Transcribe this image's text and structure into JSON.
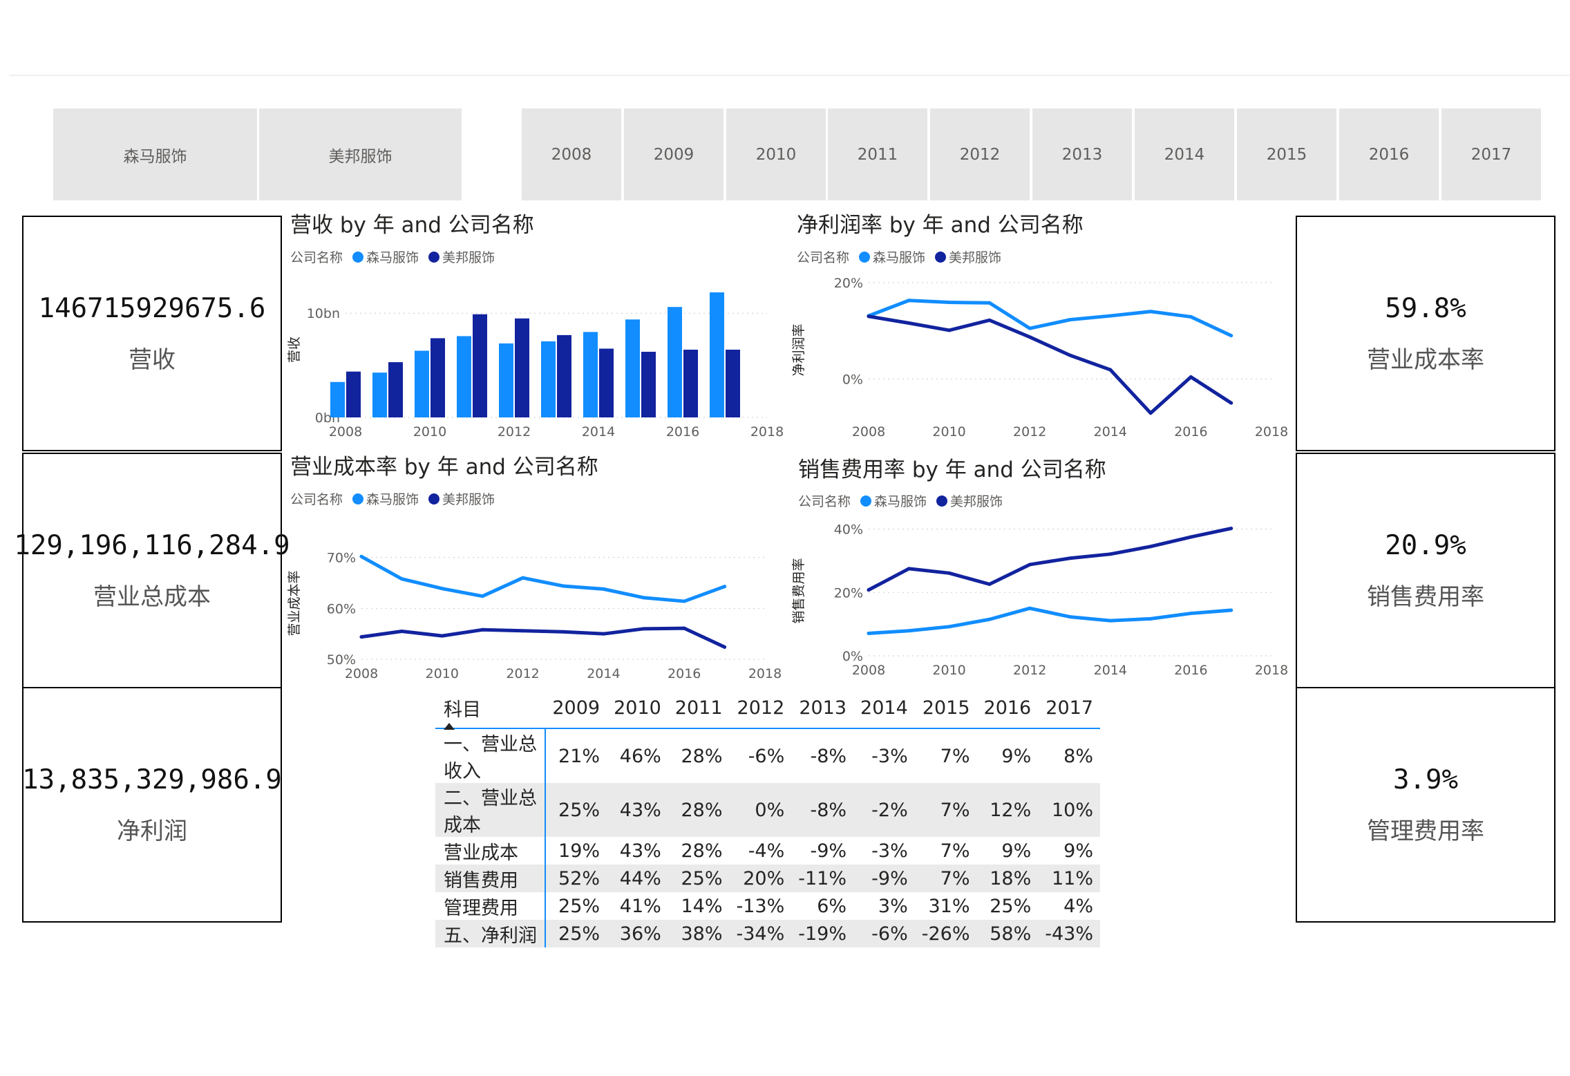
{
  "slicers": {
    "companies": [
      "森马服饰",
      "美邦服饰"
    ],
    "years": [
      "2008",
      "2009",
      "2010",
      "2011",
      "2012",
      "2013",
      "2014",
      "2015",
      "2016",
      "2017"
    ]
  },
  "kpi": {
    "revenue": {
      "value": "146715929675.6",
      "label": "营收"
    },
    "total_cost": {
      "value": "129,196,116,284.9",
      "label": "营业总成本"
    },
    "net_profit": {
      "value": "13,835,329,986.9",
      "label": "净利润"
    },
    "cost_rate": {
      "value": "59.8%",
      "label": "营业成本率"
    },
    "sales_rate": {
      "value": "20.9%",
      "label": "销售费用率"
    },
    "mgmt_rate": {
      "value": "3.9%",
      "label": "管理费用率"
    }
  },
  "colors": {
    "senma": "#118dff",
    "meibang": "#12239e",
    "accent": "#118dff"
  },
  "legend": {
    "title": "公司名称",
    "senma": "森马服饰",
    "meibang": "美邦服饰"
  },
  "chart_data": [
    {
      "type": "bar",
      "title": "营收 by 年 and 公司名称",
      "xlabel": "年",
      "ylabel": "营收",
      "x": [
        2008,
        2009,
        2010,
        2011,
        2012,
        2013,
        2014,
        2015,
        2016,
        2017
      ],
      "x_ticks": [
        "2008",
        "2010",
        "2012",
        "2014",
        "2016",
        "2018"
      ],
      "y_ticks": [
        "0bn",
        "10bn"
      ],
      "ylim": [
        0,
        13
      ],
      "series": [
        {
          "name": "森马服饰",
          "values": [
            3.4,
            4.3,
            6.4,
            7.8,
            7.1,
            7.3,
            8.2,
            9.4,
            10.6,
            12.0
          ]
        },
        {
          "name": "美邦服饰",
          "values": [
            4.4,
            5.3,
            7.6,
            9.9,
            9.5,
            7.9,
            6.6,
            6.3,
            6.5,
            6.5
          ]
        }
      ]
    },
    {
      "type": "line",
      "title": "净利润率 by 年 and 公司名称",
      "xlabel": "年",
      "ylabel": "净利润率",
      "x": [
        2008,
        2009,
        2010,
        2011,
        2012,
        2013,
        2014,
        2015,
        2016,
        2017
      ],
      "x_ticks": [
        "2008",
        "2010",
        "2012",
        "2014",
        "2016",
        "2018"
      ],
      "y_ticks": [
        "0%",
        "20%"
      ],
      "ylim": [
        -8,
        20
      ],
      "series": [
        {
          "name": "森马服饰",
          "values": [
            13.1,
            16.3,
            15.9,
            15.8,
            10.5,
            12.3,
            13.1,
            14.0,
            12.9,
            9.0
          ]
        },
        {
          "name": "美邦服饰",
          "values": [
            13.0,
            11.6,
            10.1,
            12.2,
            8.7,
            4.9,
            1.9,
            -7.1,
            0.4,
            -5.0
          ]
        }
      ]
    },
    {
      "type": "line",
      "title": "营业成本率 by 年 and 公司名称",
      "xlabel": "年",
      "ylabel": "营业成本率",
      "x": [
        2008,
        2009,
        2010,
        2011,
        2012,
        2013,
        2014,
        2015,
        2016,
        2017
      ],
      "x_ticks": [
        "2008",
        "2010",
        "2012",
        "2014",
        "2016",
        "2018"
      ],
      "y_ticks": [
        "50%",
        "60%",
        "70%"
      ],
      "ylim": [
        50,
        72
      ],
      "series": [
        {
          "name": "森马服饰",
          "values": [
            70.2,
            65.8,
            63.9,
            62.4,
            66.0,
            64.4,
            63.8,
            62.1,
            61.4,
            64.3
          ]
        },
        {
          "name": "美邦服饰",
          "values": [
            54.4,
            55.5,
            54.6,
            55.8,
            55.6,
            55.4,
            55.0,
            56.0,
            56.1,
            52.4
          ]
        }
      ]
    },
    {
      "type": "line",
      "title": "销售费用率 by 年 and 公司名称",
      "xlabel": "年",
      "ylabel": "销售费用率",
      "x": [
        2008,
        2009,
        2010,
        2011,
        2012,
        2013,
        2014,
        2015,
        2016,
        2017
      ],
      "x_ticks": [
        "2008",
        "2010",
        "2012",
        "2014",
        "2016",
        "2018"
      ],
      "y_ticks": [
        "0%",
        "20%",
        "40%"
      ],
      "ylim": [
        0,
        41
      ],
      "series": [
        {
          "name": "森马服饰",
          "values": [
            7.1,
            7.9,
            9.2,
            11.5,
            15.0,
            12.3,
            11.1,
            11.7,
            13.4,
            14.4
          ]
        },
        {
          "name": "美邦服饰",
          "values": [
            20.8,
            27.5,
            26.1,
            22.6,
            28.8,
            30.8,
            32.1,
            34.5,
            37.5,
            40.2
          ]
        }
      ]
    }
  ],
  "matrix": {
    "header": [
      "科目",
      "2009",
      "2010",
      "2011",
      "2012",
      "2013",
      "2014",
      "2015",
      "2016",
      "2017"
    ],
    "rows": [
      [
        "一、营业总收入",
        "21%",
        "46%",
        "28%",
        "-6%",
        "-8%",
        "-3%",
        "7%",
        "9%",
        "8%"
      ],
      [
        "二、营业总成本",
        "25%",
        "43%",
        "28%",
        "0%",
        "-8%",
        "-2%",
        "7%",
        "12%",
        "10%"
      ],
      [
        "营业成本",
        "19%",
        "43%",
        "28%",
        "-4%",
        "-9%",
        "-3%",
        "7%",
        "9%",
        "9%"
      ],
      [
        "销售费用",
        "52%",
        "44%",
        "25%",
        "20%",
        "-11%",
        "-9%",
        "7%",
        "18%",
        "11%"
      ],
      [
        "管理费用",
        "25%",
        "41%",
        "14%",
        "-13%",
        "6%",
        "3%",
        "31%",
        "25%",
        "4%"
      ],
      [
        "五、净利润",
        "25%",
        "36%",
        "38%",
        "-34%",
        "-19%",
        "-6%",
        "-26%",
        "58%",
        "-43%"
      ]
    ]
  }
}
